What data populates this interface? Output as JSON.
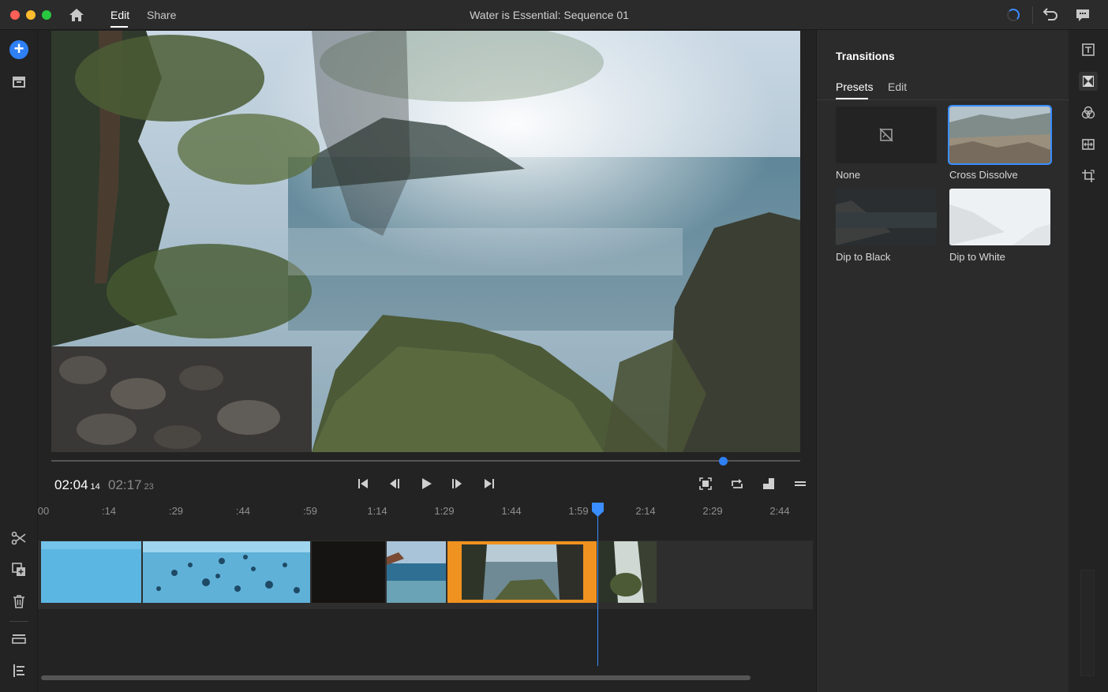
{
  "window": {
    "title": "Water is Essential: Sequence 01",
    "tabs": [
      {
        "label": "Edit",
        "active": true
      },
      {
        "label": "Share",
        "active": false
      }
    ],
    "icons": [
      "home-icon",
      "loading-spinner",
      "undo-icon",
      "feedback-icon"
    ]
  },
  "left_toolbar": {
    "top_icons": [
      "add-media-icon",
      "project-assets-icon"
    ],
    "bottom_icons": [
      "split-clip-icon",
      "duplicate-icon",
      "delete-icon",
      "track-layout-icon",
      "timeline-list-icon"
    ]
  },
  "player": {
    "current_time": "02:04",
    "current_frames": "14",
    "total_time": "02:17",
    "total_frames": "23",
    "scrub_position": 0.896,
    "controls": [
      "go-to-start",
      "step-back",
      "play",
      "step-forward",
      "go-to-end"
    ],
    "right_controls": [
      "fit-view-icon",
      "loop-icon",
      "resize-panel-icon",
      "menu-icon"
    ]
  },
  "timeline": {
    "ruler_labels": [
      "00",
      ":14",
      ":29",
      ":44",
      ":59",
      "1:14",
      "1:29",
      "1:44",
      "1:59",
      "2:14",
      "2:29",
      "2:44"
    ],
    "clips": [
      {
        "name": "clip-blue-water",
        "selected": false
      },
      {
        "name": "clip-bubbles",
        "selected": false
      },
      {
        "name": "clip-black",
        "selected": false
      },
      {
        "name": "clip-beach",
        "selected": false
      },
      {
        "name": "clip-coast-rocks",
        "selected": true
      },
      {
        "name": "clip-forest",
        "selected": false
      }
    ],
    "playhead_time": "2:04"
  },
  "transitions_panel": {
    "title": "Transitions",
    "tabs": [
      {
        "label": "Presets",
        "active": true
      },
      {
        "label": "Edit",
        "active": false
      }
    ],
    "presets": [
      {
        "label": "None",
        "selected": false
      },
      {
        "label": "Cross Dissolve",
        "selected": true
      },
      {
        "label": "Dip to Black",
        "selected": false
      },
      {
        "label": "Dip to White",
        "selected": false
      }
    ]
  },
  "right_rail": {
    "icons": [
      "titles-icon",
      "transitions-icon",
      "color-icon",
      "speed-icon",
      "crop-icon"
    ],
    "active": "transitions-icon"
  },
  "colors": {
    "accent": "#2f7ff5",
    "selection": "#f0921f",
    "background": "#232323",
    "panel": "#2b2b2b"
  }
}
